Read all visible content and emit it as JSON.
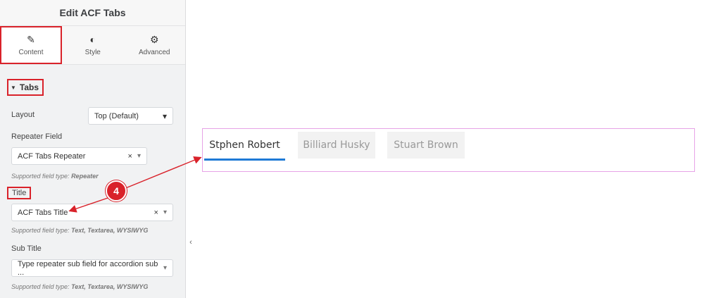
{
  "panel": {
    "title": "Edit ACF Tabs",
    "tabs": [
      {
        "label": "Content",
        "icon": "pencil-icon"
      },
      {
        "label": "Style",
        "icon": "half-circle-icon"
      },
      {
        "label": "Advanced",
        "icon": "gear-icon"
      }
    ],
    "section_title": "Tabs",
    "layout_label": "Layout",
    "layout_value": "Top (Default)",
    "repeater_label": "Repeater Field",
    "repeater_value": "ACF Tabs Repeater",
    "repeater_help_prefix": "Supported field type: ",
    "repeater_help_types": "Repeater",
    "title_label": "Title",
    "title_value": "ACF Tabs Title",
    "title_help_prefix": "Supported field type: ",
    "title_help_types": "Text, Textarea, WYSIWYG",
    "subtitle_label": "Sub Title",
    "subtitle_placeholder": "Type repeater sub field for accordion sub ...",
    "subtitle_help_prefix": "Supported field type: ",
    "subtitle_help_types": "Text, Textarea, WYSIWYG",
    "clear_glyph": "×",
    "dropdown_glyph": "▾",
    "collapse_glyph": "‹"
  },
  "preview": {
    "tabs": [
      "Stphen Robert",
      "Billiard Husky",
      "Stuart Brown"
    ],
    "active_index": 0,
    "accent_color": "#1f7ad6"
  },
  "annotation": {
    "step_number": "4",
    "color": "#d9222a"
  }
}
